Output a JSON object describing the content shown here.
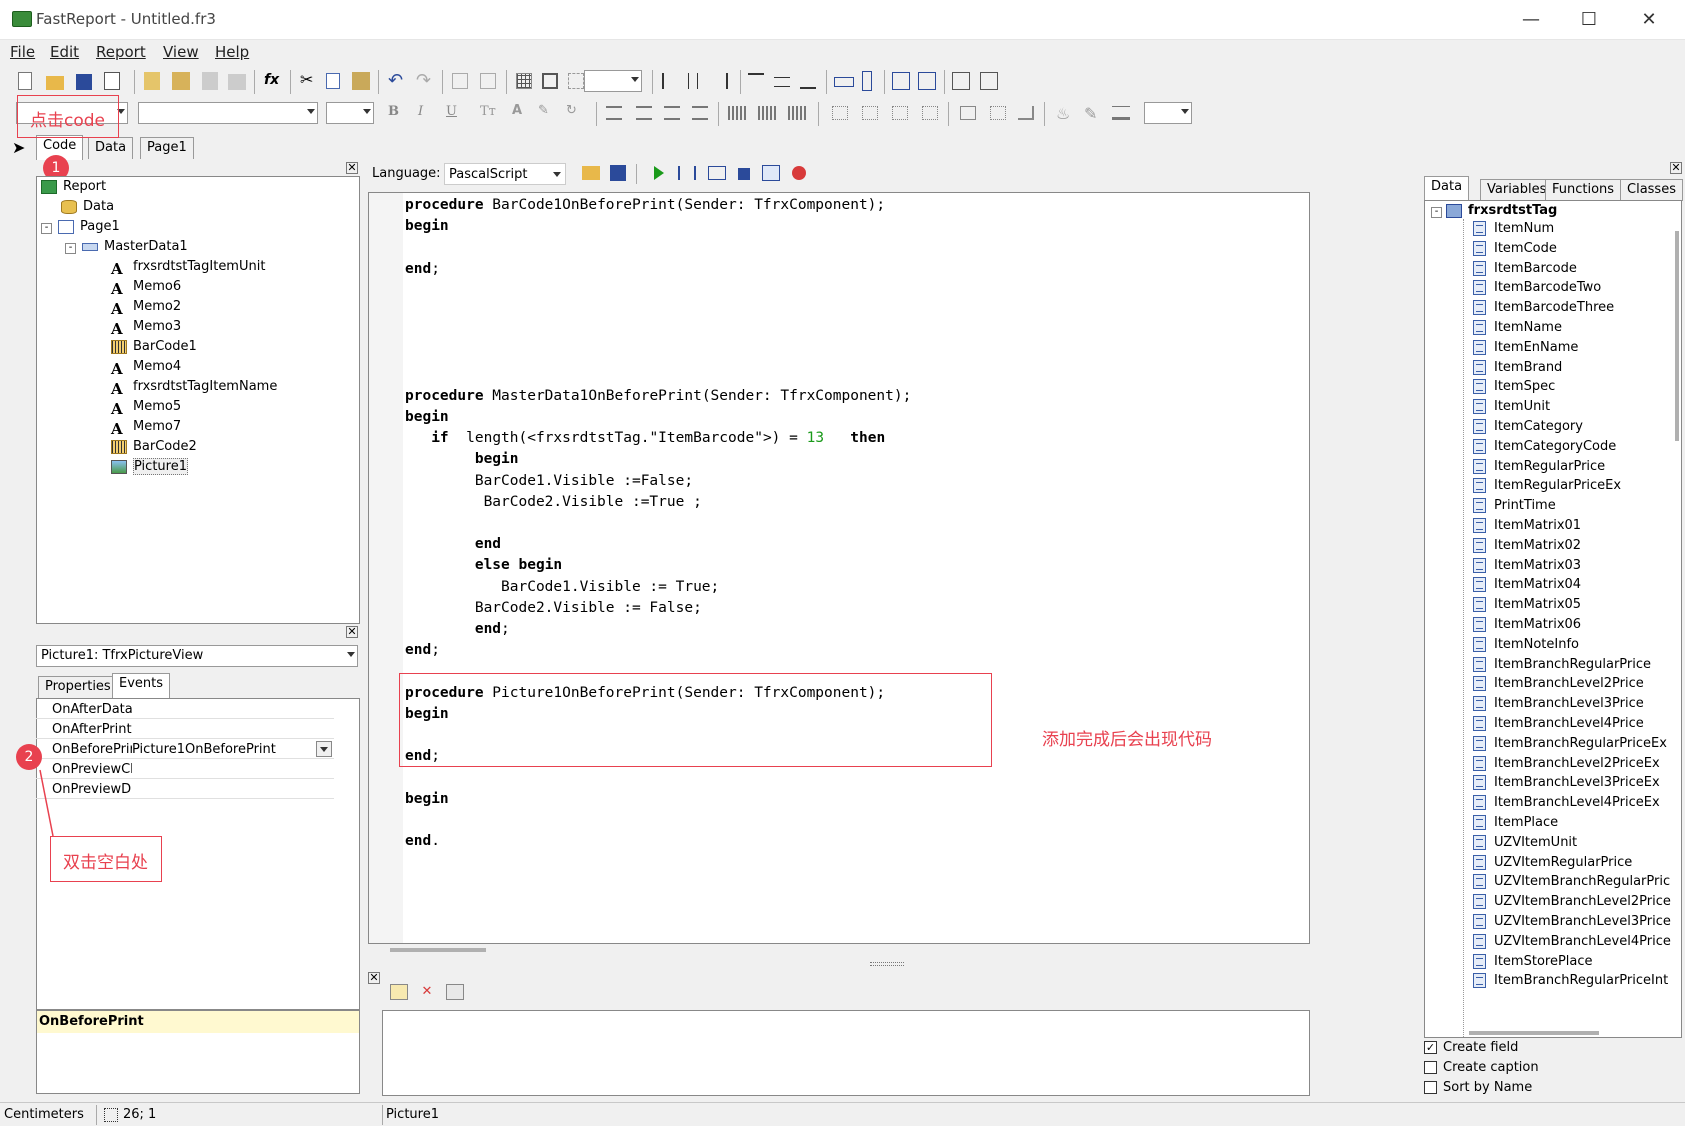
{
  "window": {
    "title": "FastReport - Untitled.fr3"
  },
  "menu": [
    "File",
    "Edit",
    "Report",
    "View",
    "Help"
  ],
  "annotations": {
    "click_code": "点击code",
    "badge1": "1",
    "badge2": "2",
    "double_click": "双击空白处",
    "code_appears": "添加完成后会出现代码"
  },
  "page_tabs": [
    "Code",
    "Data",
    "Page1"
  ],
  "language": {
    "label": "Language:",
    "value": "PascalScript"
  },
  "report_tree": {
    "root": "Report",
    "data": "Data",
    "page": "Page1",
    "band": "MasterData1",
    "items": [
      {
        "label": "frxsrdtstTagItemUnit",
        "icon": "text-icon"
      },
      {
        "label": "Memo6",
        "icon": "text-icon"
      },
      {
        "label": "Memo2",
        "icon": "text-icon"
      },
      {
        "label": "Memo3",
        "icon": "text-icon"
      },
      {
        "label": "BarCode1",
        "icon": "barcode-icon"
      },
      {
        "label": "Memo4",
        "icon": "text-icon"
      },
      {
        "label": "frxsrdtstTagItemName",
        "icon": "text-icon"
      },
      {
        "label": "Memo5",
        "icon": "text-icon"
      },
      {
        "label": "Memo7",
        "icon": "text-icon"
      },
      {
        "label": "BarCode2",
        "icon": "barcode-icon"
      },
      {
        "label": "Picture1",
        "icon": "picture-icon"
      }
    ]
  },
  "object_inspector": {
    "selected": "Picture1: TfrxPictureView",
    "tabs": [
      "Properties",
      "Events"
    ],
    "events": [
      {
        "name": "OnAfterData",
        "value": ""
      },
      {
        "name": "OnAfterPrint",
        "value": ""
      },
      {
        "name": "OnBeforePrir",
        "value": "Picture1OnBeforePrint"
      },
      {
        "name": "OnPreviewCli",
        "value": ""
      },
      {
        "name": "OnPreviewDb",
        "value": ""
      }
    ],
    "description": "OnBeforePrint"
  },
  "code_lines": [
    "procedure BarCode1OnBeforePrint(Sender: TfrxComponent);",
    "begin",
    "",
    "end;",
    "",
    "",
    "",
    "",
    "",
    "procedure MasterData1OnBeforePrint(Sender: TfrxComponent);",
    "begin",
    "   if  length(<frxsrdtstTag.\"ItemBarcode\">) = 13   then",
    "        begin",
    "        BarCode1.Visible :=False;",
    "         BarCode2.Visible :=True ;",
    "",
    "        end",
    "        else begin",
    "           BarCode1.Visible := True;",
    "        BarCode2.Visible := False;",
    "        end;",
    "end;",
    "",
    "procedure Picture1OnBeforePrint(Sender: TfrxComponent);",
    "begin",
    "",
    "end;",
    "",
    "begin",
    "",
    "end."
  ],
  "data_panel": {
    "tabs": [
      "Data",
      "Variables",
      "Functions",
      "Classes"
    ],
    "dataset": "frxsrdtstTag",
    "fields": [
      "ItemNum",
      "ItemCode",
      "ItemBarcode",
      "ItemBarcodeTwo",
      "ItemBarcodeThree",
      "ItemName",
      "ItemEnName",
      "ItemBrand",
      "ItemSpec",
      "ItemUnit",
      "ItemCategory",
      "ItemCategoryCode",
      "ItemRegularPrice",
      "ItemRegularPriceEx",
      "PrintTime",
      "ItemMatrix01",
      "ItemMatrix02",
      "ItemMatrix03",
      "ItemMatrix04",
      "ItemMatrix05",
      "ItemMatrix06",
      "ItemNoteInfo",
      "ItemBranchRegularPrice",
      "ItemBranchLevel2Price",
      "ItemBranchLevel3Price",
      "ItemBranchLevel4Price",
      "ItemBranchRegularPriceEx",
      "ItemBranchLevel2PriceEx",
      "ItemBranchLevel3PriceEx",
      "ItemBranchLevel4PriceEx",
      "ItemPlace",
      "UZVItemUnit",
      "UZVItemRegularPrice",
      "UZVItemBranchRegularPric",
      "UZVItemBranchLevel2Price",
      "UZVItemBranchLevel3Price",
      "UZVItemBranchLevel4Price",
      "ItemStorePlace",
      "ItemBranchRegularPriceInt"
    ],
    "options": [
      {
        "label": "Create field",
        "checked": true
      },
      {
        "label": "Create caption",
        "checked": false
      },
      {
        "label": "Sort by Name",
        "checked": false
      }
    ]
  },
  "status": {
    "units": "Centimeters",
    "position": "26; 1",
    "object": "Picture1"
  },
  "colors": {
    "accent_red": "#e8414f",
    "number_green": "#1a9a1a"
  }
}
